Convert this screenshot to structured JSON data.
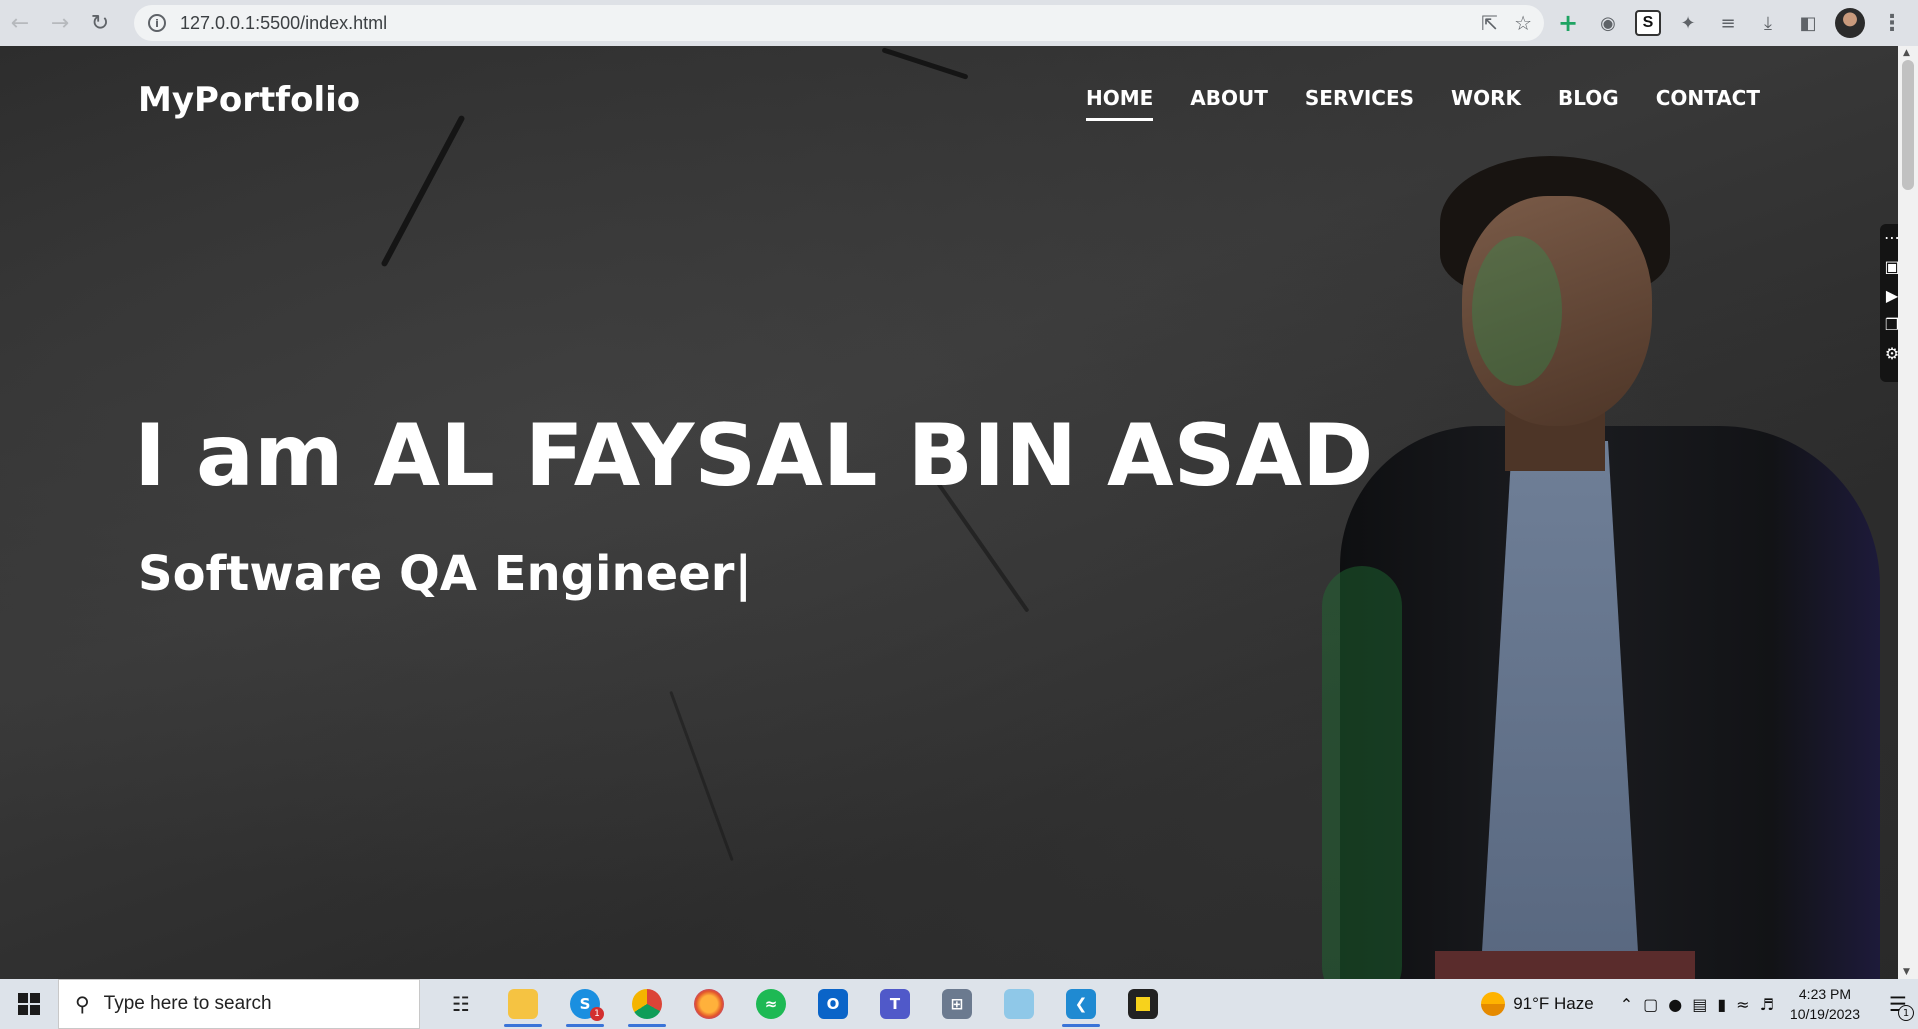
{
  "browser": {
    "url": "127.0.0.1:5500/index.html",
    "extensions": [
      "plus-icon",
      "dashboard-icon",
      "s-extension-icon",
      "puzzle-icon",
      "reading-list-icon",
      "download-icon",
      "side-panel-icon",
      "profile-avatar",
      "kebab-menu-icon"
    ]
  },
  "site": {
    "logo": "MyPortfolio",
    "nav": [
      {
        "label": "HOME",
        "active": true
      },
      {
        "label": "ABOUT",
        "active": false
      },
      {
        "label": "SERVICES",
        "active": false
      },
      {
        "label": "WORK",
        "active": false
      },
      {
        "label": "BLOG",
        "active": false
      },
      {
        "label": "CONTACT",
        "active": false
      }
    ],
    "headline": "I am AL FAYSAL BIN ASAD",
    "subtitle": "Software QA Engineer|"
  },
  "taskbar": {
    "search_placeholder": "Type here to search",
    "apps": [
      {
        "name": "task-view",
        "active": false
      },
      {
        "name": "file-explorer",
        "active": true
      },
      {
        "name": "skype",
        "active": true,
        "badge": "1"
      },
      {
        "name": "chrome",
        "active": true
      },
      {
        "name": "firefox",
        "active": false
      },
      {
        "name": "spotify",
        "active": false
      },
      {
        "name": "outlook",
        "active": false
      },
      {
        "name": "teams",
        "active": false
      },
      {
        "name": "calculator",
        "active": false
      },
      {
        "name": "notepad",
        "active": false
      },
      {
        "name": "vscode",
        "active": true
      },
      {
        "name": "sticky-notes",
        "active": false
      }
    ],
    "weather": "91°F  Haze",
    "time": "4:23 PM",
    "date": "10/19/2023",
    "notification_count": "1"
  }
}
